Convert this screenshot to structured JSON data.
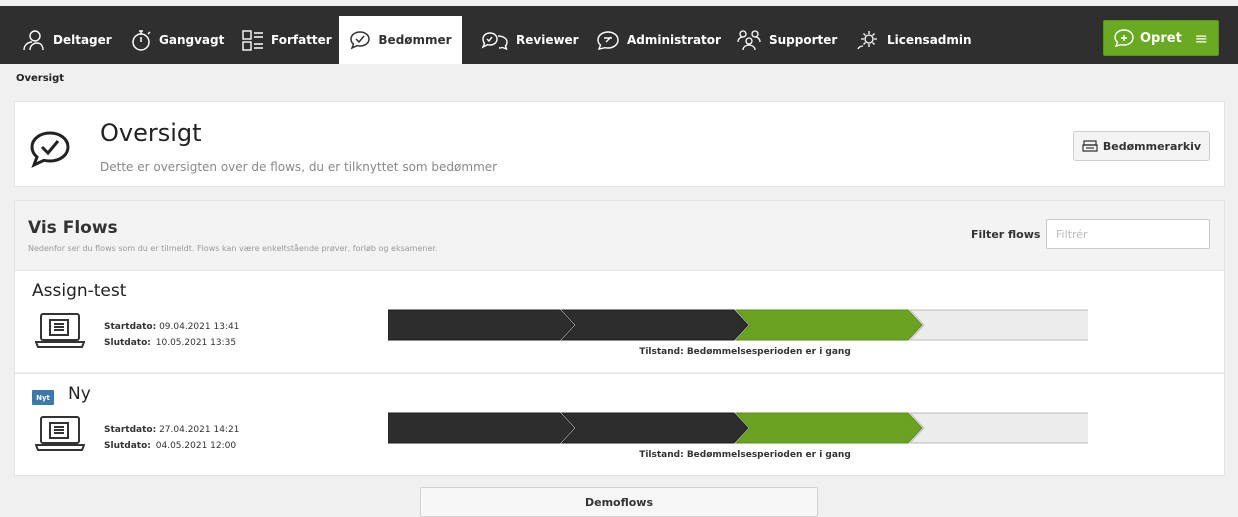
{
  "nav": {
    "tabs": [
      {
        "label": "Deltager",
        "icon": "participant-icon"
      },
      {
        "label": "Gangvagt",
        "icon": "stopwatch-icon"
      },
      {
        "label": "Forfatter",
        "icon": "author-icon"
      },
      {
        "label": "Bedømmer",
        "icon": "check-bubble-icon",
        "active": true
      },
      {
        "label": "Reviewer",
        "icon": "review-icon"
      },
      {
        "label": "Administrator",
        "icon": "admin-icon"
      },
      {
        "label": "Supporter",
        "icon": "supporter-icon"
      },
      {
        "label": "Licensadmin",
        "icon": "gear-icon"
      }
    ],
    "create_label": "Opret",
    "menu_symbol": "≡"
  },
  "breadcrumb": "Oversigt",
  "header": {
    "title": "Oversigt",
    "subtitle": "Dette er oversigten over de flows, du er tilknyttet som bedømmer",
    "archive_button": "Bedømmerarkiv"
  },
  "flows": {
    "title": "Vis Flows",
    "subtitle": "Nedenfor ser du flows som du er tilmeldt. Flows kan være enkeltstående prøver, forløb og eksamener.",
    "filter_label": "Filter flows",
    "filter_placeholder": "Filtrér",
    "items": [
      {
        "name": "Assign-test",
        "badge": "",
        "start_label": "Startdato:",
        "start": "09.04.2021 13:41",
        "end_label": "Slutdato:",
        "end": "10.05.2021 13:35",
        "state": "Tilstand: Bedømmelsesperioden er i gang"
      },
      {
        "name": "Ny",
        "badge": "Nyt",
        "start_label": "Startdato:",
        "start": "27.04.2021 14:21",
        "end_label": "Slutdato:",
        "end": "04.05.2021 12:00",
        "state": "Tilstand: Bedømmelsesperioden er i gang"
      }
    ],
    "step_states": [
      "done",
      "done",
      "active",
      "pending"
    ]
  },
  "demo_button": "Demoflows",
  "colors": {
    "topbar": "#2f2f2f",
    "accent_green": "#6aaa22",
    "badge_blue": "#3a79a9"
  }
}
